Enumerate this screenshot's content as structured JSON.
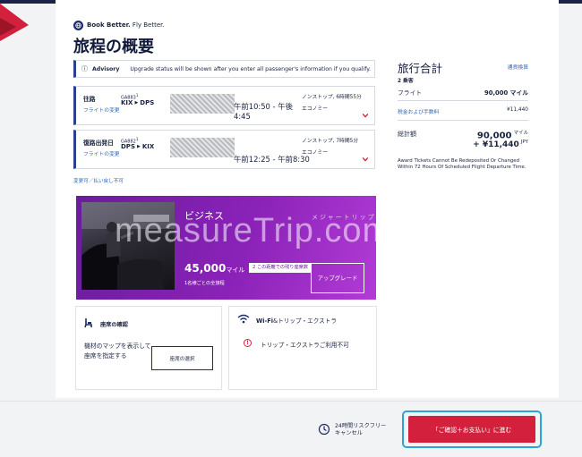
{
  "colors": {
    "navy": "#1b2148",
    "accent_blue": "#3564b0",
    "brand_red": "#d2203d",
    "upsell_purple": "#8a22b8",
    "highlight_cyan": "#2aa6d6"
  },
  "brand": {
    "tagline_bold": "Book Better.",
    "tagline_rest": " Fly Better."
  },
  "page_title": "旅程の概要",
  "advisory": {
    "icon": "info-icon",
    "title": "Advisory",
    "message": "Upgrade status will be shown after you enter all passenger's information if you qualify."
  },
  "flights": [
    {
      "label": "往路",
      "change_link": "フライトの変更",
      "flight_no": "GA883",
      "flight_sup": "1",
      "origin": "KIX",
      "destination": "DPS",
      "time_line1": "午前10:50 - 午後",
      "time_line2": "4:45",
      "duration": "ノンストップ, 6時間55分",
      "cabin": "エコノミー"
    },
    {
      "label": "復路出発日",
      "change_link": "フライトの変更",
      "flight_no": "GA882",
      "flight_sup": "1",
      "origin": "DPS",
      "destination": "KIX",
      "time_line1": "午前12:25 - 午前8:30",
      "time_line2": "",
      "duration": "ノンストップ, 7時間5分",
      "cabin": "エコノミー"
    }
  ],
  "change_note": "変更可／払い戻し不可",
  "upsell": {
    "cabin_name": "ビジネス",
    "miles": "45,000",
    "miles_unit": "マイル",
    "seat_badge": "2 この距離での残り座席数",
    "per_person": "1名様ごとの全旅程",
    "upgrade_button": "アップグレード"
  },
  "seat_card": {
    "title": "座席の確認",
    "text": "機材のマップを表示して座席を指定する",
    "button": "座席の選択"
  },
  "wifi_card": {
    "title_bold": "Wi-Fi",
    "title_rest": "&トリップ・エクストラ",
    "message": "トリップ・エクストラご利用不可"
  },
  "summary": {
    "title": "旅行合計",
    "currency_link": "通貨換算",
    "passengers": "2 乗客",
    "fare_label": "フライト",
    "fare_value": "90,000 マイル",
    "tax_label": "税金および手数料",
    "tax_value": "¥11,440",
    "total_label": "総計額",
    "total_miles": "90,000",
    "total_miles_unit": "マイル",
    "total_yen": "+ ¥11,440",
    "total_yen_unit": "JPY",
    "note": "Award Tickets Cannot Be Redeposited Or Changed Within 72 Hours Of Scheduled Flight Departure Time."
  },
  "footer": {
    "risk_free_line1": "24時間リスクフリー",
    "risk_free_line2": "キャンセル",
    "pay_button": "「ご確認＋お支払い」に進む"
  },
  "watermark": {
    "text": "measureTrip.com",
    "kana": "メジャートリップ"
  }
}
